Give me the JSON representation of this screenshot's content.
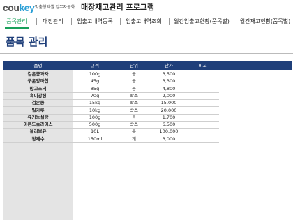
{
  "header": {
    "logo_part1": "cou",
    "logo_part2": "key",
    "tagline": "맞춤형엑셀 업무자동화",
    "app_title": "매장재고관리 프로그램"
  },
  "tabs": [
    {
      "label": "품목관리",
      "active": true
    },
    {
      "label": "매장관리",
      "active": false
    },
    {
      "label": "입출고내역등록",
      "active": false
    },
    {
      "label": "입출고내역조회",
      "active": false
    },
    {
      "label": "월간입출고현황(품목별)",
      "active": false
    },
    {
      "label": "월간재고현황(품목별)",
      "active": false
    }
  ],
  "page_title": "품목 관리",
  "table": {
    "columns": [
      "품명",
      "규격",
      "단위",
      "단가",
      "비고"
    ],
    "rows": [
      [
        "검은콩과자",
        "100g",
        "봉",
        "3,500",
        ""
      ],
      [
        "구운양파칩",
        "45g",
        "봉",
        "3,300",
        ""
      ],
      [
        "망고스낵",
        "85g",
        "봉",
        "4,800",
        ""
      ],
      [
        "흑미강정",
        "70g",
        "박스",
        "2,000",
        ""
      ],
      [
        "검은콩",
        "15kg",
        "박스",
        "15,000",
        ""
      ],
      [
        "밀가루",
        "10kg",
        "박스",
        "20,000",
        ""
      ],
      [
        "유기농설탕",
        "100g",
        "봉",
        "1,700",
        ""
      ],
      [
        "아몬드슬라이스",
        "500g",
        "박스",
        "6,500",
        ""
      ],
      [
        "올리브유",
        "10L",
        "통",
        "100,000",
        ""
      ],
      [
        "정제수",
        "150ml",
        "개",
        "3,000",
        ""
      ]
    ]
  },
  "colors": {
    "header_bg": "#1f3f7a",
    "accent_tab": "#18a05a",
    "logo_blue": "#2a9fd6",
    "name_column_bg": "#e4e4e4"
  }
}
